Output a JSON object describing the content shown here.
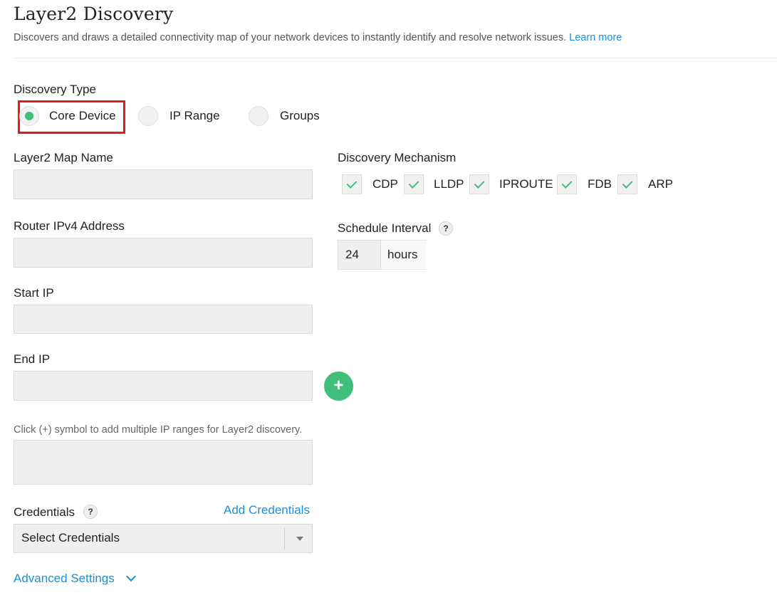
{
  "header": {
    "title": "Layer2 Discovery",
    "subtitle": "Discovers and draws a detailed connectivity map of your network devices to instantly identify and resolve network issues.",
    "learn_more": "Learn more"
  },
  "discovery_type": {
    "label": "Discovery Type",
    "options": [
      {
        "label": "Core Device",
        "selected": true
      },
      {
        "label": "IP Range",
        "selected": false
      },
      {
        "label": "Groups",
        "selected": false
      }
    ]
  },
  "fields": {
    "map_name": {
      "label": "Layer2 Map Name",
      "value": ""
    },
    "router_ip": {
      "label": "Router IPv4 Address",
      "value": ""
    },
    "start_ip": {
      "label": "Start IP",
      "value": ""
    },
    "end_ip": {
      "label": "End IP",
      "value": ""
    },
    "ip_ranges": {
      "hint": "Click (+) symbol to add multiple IP ranges for Layer2 discovery.",
      "value": ""
    }
  },
  "mechanism": {
    "label": "Discovery Mechanism",
    "options": [
      {
        "label": "CDP",
        "checked": true
      },
      {
        "label": "LLDP",
        "checked": true
      },
      {
        "label": "IPROUTE",
        "checked": true
      },
      {
        "label": "FDB",
        "checked": true
      },
      {
        "label": "ARP",
        "checked": true
      }
    ]
  },
  "schedule": {
    "label": "Schedule Interval",
    "help": "?",
    "value": "24",
    "unit": "hours"
  },
  "add_range": {
    "symbol": "+"
  },
  "credentials": {
    "label": "Credentials",
    "help": "?",
    "add_link": "Add Credentials",
    "selected": "Select Credentials"
  },
  "advanced": {
    "label": "Advanced Settings"
  },
  "colors": {
    "accent_green": "#3fbf7a",
    "link_blue": "#1a8fd6",
    "highlight_red": "#e01e1e"
  }
}
